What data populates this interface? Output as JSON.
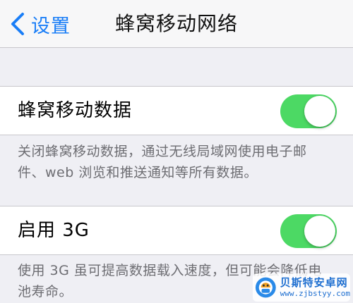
{
  "navbar": {
    "back_label": "设置",
    "title": "蜂窝移动网络",
    "back_icon": "chevron-left-icon"
  },
  "cellular_data": {
    "label": "蜂窝移动数据",
    "enabled": true,
    "footnote": "关闭蜂窝移动数据，通过无线局域网使用电子邮件、web 浏览和推送通知等所有数据。"
  },
  "enable_3g": {
    "label": "启用 3G",
    "enabled": true,
    "footnote": "使用 3G 虽可提高数据载入速度，但可能会降低电池寿命。"
  },
  "watermark": {
    "name": "贝斯特安卓网",
    "url": "www.zjbstyy.com"
  },
  "colors": {
    "accent": "#1a7ef7",
    "toggle_on": "#4cd964",
    "background": "#efeff4",
    "footnote_text": "#6d6d72"
  }
}
